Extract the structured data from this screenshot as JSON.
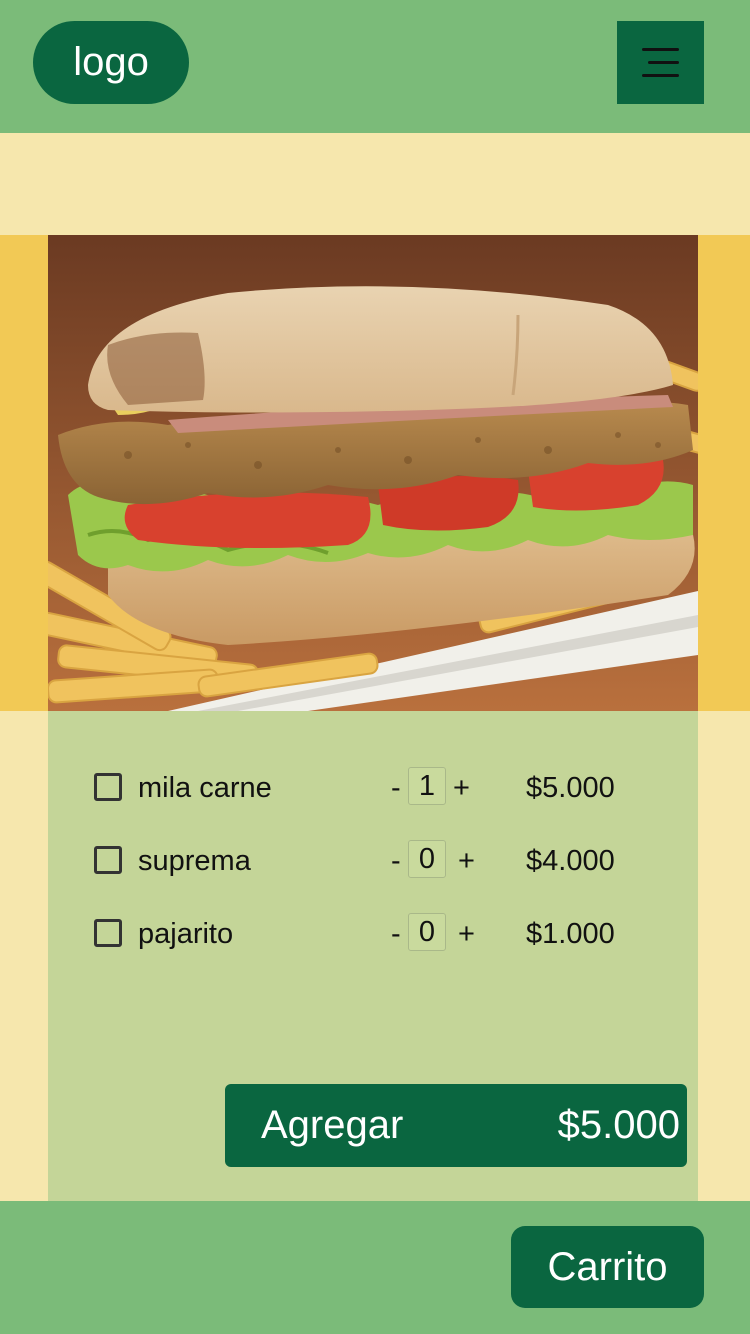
{
  "header": {
    "logo_label": "logo",
    "menu_icon": "hamburger-menu-icon"
  },
  "product": {
    "image_alt": "Sandwich de milanesa con lechuga y tomate, con papas fritas",
    "options": [
      {
        "name": "mila carne",
        "qty": "1",
        "price": "$5.000",
        "checked": false
      },
      {
        "name": "suprema",
        "qty": "0",
        "price": "$4.000",
        "checked": false
      },
      {
        "name": "pajarito",
        "qty": "0",
        "price": "$1.000",
        "checked": false
      }
    ],
    "minus_label": "-",
    "plus_label": "+"
  },
  "add_button": {
    "label": "Agregar",
    "total": "$5.000"
  },
  "footer": {
    "cart_label": "Carrito"
  },
  "colors": {
    "brand_dark": "#0a6640",
    "header_green": "#7bbb79",
    "panel_green": "#c4d598",
    "cream": "#f6e7ad",
    "yellow": "#f2c955"
  }
}
